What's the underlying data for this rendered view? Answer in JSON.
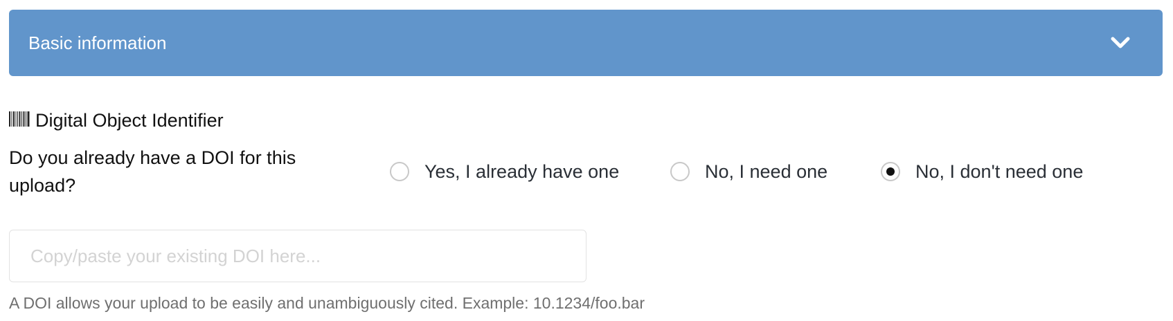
{
  "accordion": {
    "title": "Basic information",
    "expanded": true,
    "bg_color": "#6195cb",
    "icon": "chevron-down-icon"
  },
  "doi_section": {
    "icon": "barcode-icon",
    "label": "Digital Object Identifier",
    "question": "Do you already have a DOI for this upload?",
    "options": [
      {
        "label": "Yes, I already have one",
        "selected": false
      },
      {
        "label": "No, I need one",
        "selected": false
      },
      {
        "label": "No, I don't need one",
        "selected": true
      }
    ],
    "input": {
      "value": "",
      "placeholder": "Copy/paste your existing DOI here..."
    },
    "help_text": "A DOI allows your upload to be easily and unambiguously cited. Example: 10.1234/foo.bar"
  }
}
